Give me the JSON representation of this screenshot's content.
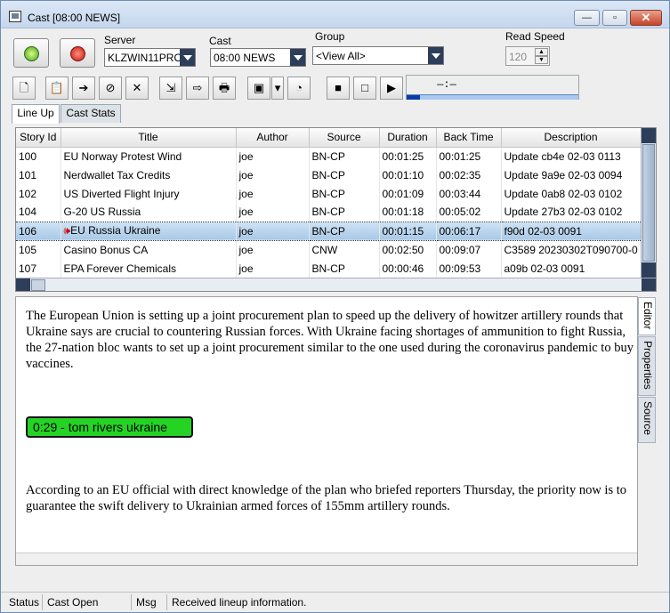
{
  "window": {
    "title": "Cast [08:00 NEWS]",
    "min_label": "—",
    "max_label": "▫",
    "close_label": "✕"
  },
  "controls": {
    "server_label": "Server",
    "server_value": "KLZWIN11PRO",
    "cast_label": "Cast",
    "cast_value": "08:00 NEWS",
    "group_label": "Group",
    "group_value": "<View All>",
    "read_speed_label": "Read Speed",
    "read_speed_value": "120",
    "spin_up": "▲",
    "spin_down": "▼"
  },
  "toolbar": {
    "icons": [
      "new-icon",
      "copy-icon",
      "move-icon",
      "refresh-icon",
      "delete-icon",
      "import-icon",
      "export-icon",
      "print-icon",
      "film-icon",
      "dropdown-icon",
      "timer-icon",
      "stop-icon",
      "blank-icon",
      "play-icon"
    ],
    "glyphs": [
      "🗋",
      "📋",
      "➔",
      "⊘",
      "✕",
      "⇲",
      "⇨",
      "🖶",
      "▣",
      "▾",
      "◔",
      "■",
      "□",
      "▶"
    ],
    "timer_display": "—:—",
    "progress_fraction": 0.08
  },
  "tabs": {
    "lineup": "Line Up",
    "caststats": "Cast Stats"
  },
  "grid": {
    "columns": [
      "Story Id",
      "Title",
      "Author",
      "Source",
      "Duration",
      "Back Time",
      "Description"
    ],
    "rows": [
      [
        "100",
        "EU Norway Protest Wind",
        "joe",
        "BN-CP",
        "00:01:25",
        "00:01:25",
        "Update cb4e 02-03 0113"
      ],
      [
        "101",
        "Nerdwallet Tax Credits",
        "joe",
        "BN-CP",
        "00:01:10",
        "00:02:35",
        "Update 9a9e 02-03 0094"
      ],
      [
        "102",
        "US Diverted Flight Injury",
        "joe",
        "BN-CP",
        "00:01:09",
        "00:03:44",
        "Update 0ab8 02-03 0102"
      ],
      [
        "104",
        "G-20 US Russia",
        "joe",
        "BN-CP",
        "00:01:18",
        "00:05:02",
        "Update 27b3 02-03 0102"
      ],
      [
        "106",
        "EU Russia Ukraine",
        "joe",
        "BN-CP",
        "00:01:15",
        "00:06:17",
        "f90d 02-03 0091"
      ],
      [
        "105",
        "Casino Bonus CA",
        "joe",
        "CNW",
        "00:02:50",
        "00:09:07",
        "C3589 20230302T090700-0"
      ],
      [
        "107",
        "EPA Forever Chemicals",
        "joe",
        "BN-CP",
        "00:00:46",
        "00:09:53",
        "a09b 02-03 0091"
      ]
    ],
    "selected_row": 4
  },
  "editor": {
    "para1": "The European Union is setting up a joint procurement plan to speed up the delivery of howitzer artillery rounds that Ukraine says are crucial to countering Russian forces. With Ukraine facing shortages of ammunition to fight Russia, the 27-nation bloc wants to set up a joint procurement similar to the one used during the coronavirus pandemic to buy vaccines.",
    "cue": "0:29 - tom rivers ukraine",
    "para2": "According to an EU official with direct knowledge of the plan who briefed reporters Thursday, the priority now is to guarantee the swift delivery to Ukrainian armed forces of 155mm artillery rounds."
  },
  "side_tabs": {
    "editor": "Editor",
    "properties": "Properties",
    "source": "Source"
  },
  "status": {
    "status_label": "Status",
    "cast_state": "Cast Open",
    "msg_label": "Msg",
    "message": "Received lineup information."
  },
  "colors": {
    "cue_bg": "#25d325",
    "selected_row": "#a9c8e6",
    "progress": "#0a3ca8"
  }
}
